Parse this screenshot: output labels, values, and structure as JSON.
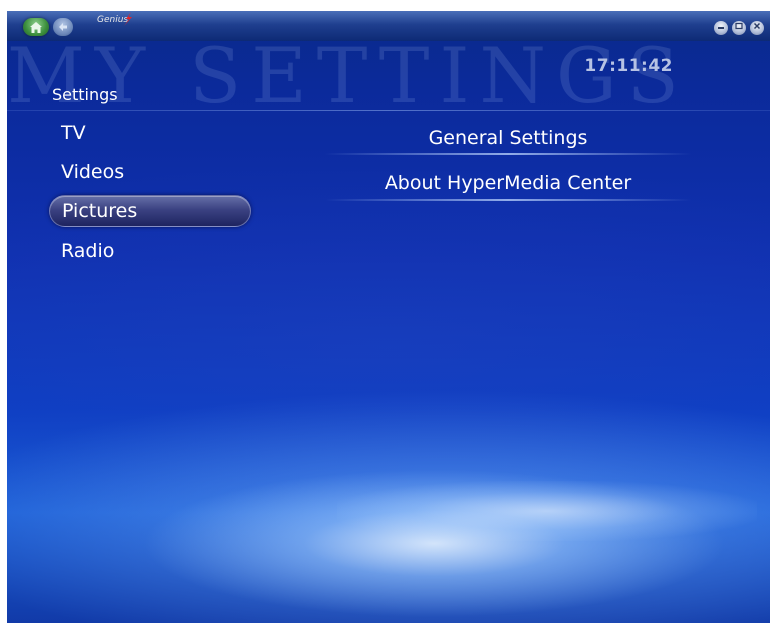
{
  "window": {
    "brand": "Genius",
    "clock": "17:11:42",
    "background_title": "MY SETTINGS",
    "buttons": {
      "home_icon": "home-icon",
      "back_icon": "back-arrow-icon",
      "minimize_icon": "minimize-icon",
      "restore_icon": "restore-icon",
      "close_icon": "close-icon"
    }
  },
  "page": {
    "title": "Settings"
  },
  "sidebar": {
    "items": [
      {
        "label": "TV",
        "selected": false
      },
      {
        "label": "Videos",
        "selected": false
      },
      {
        "label": "Pictures",
        "selected": true
      },
      {
        "label": "Radio",
        "selected": false
      }
    ]
  },
  "menu": {
    "items": [
      {
        "label": "General Settings"
      },
      {
        "label": "About HyperMedia Center"
      }
    ]
  },
  "colors": {
    "background_top": "#0a2a8a",
    "background_bottom": "#1d5fd6",
    "selection": "#3b4282",
    "clock_text": "#b6c2e4"
  }
}
